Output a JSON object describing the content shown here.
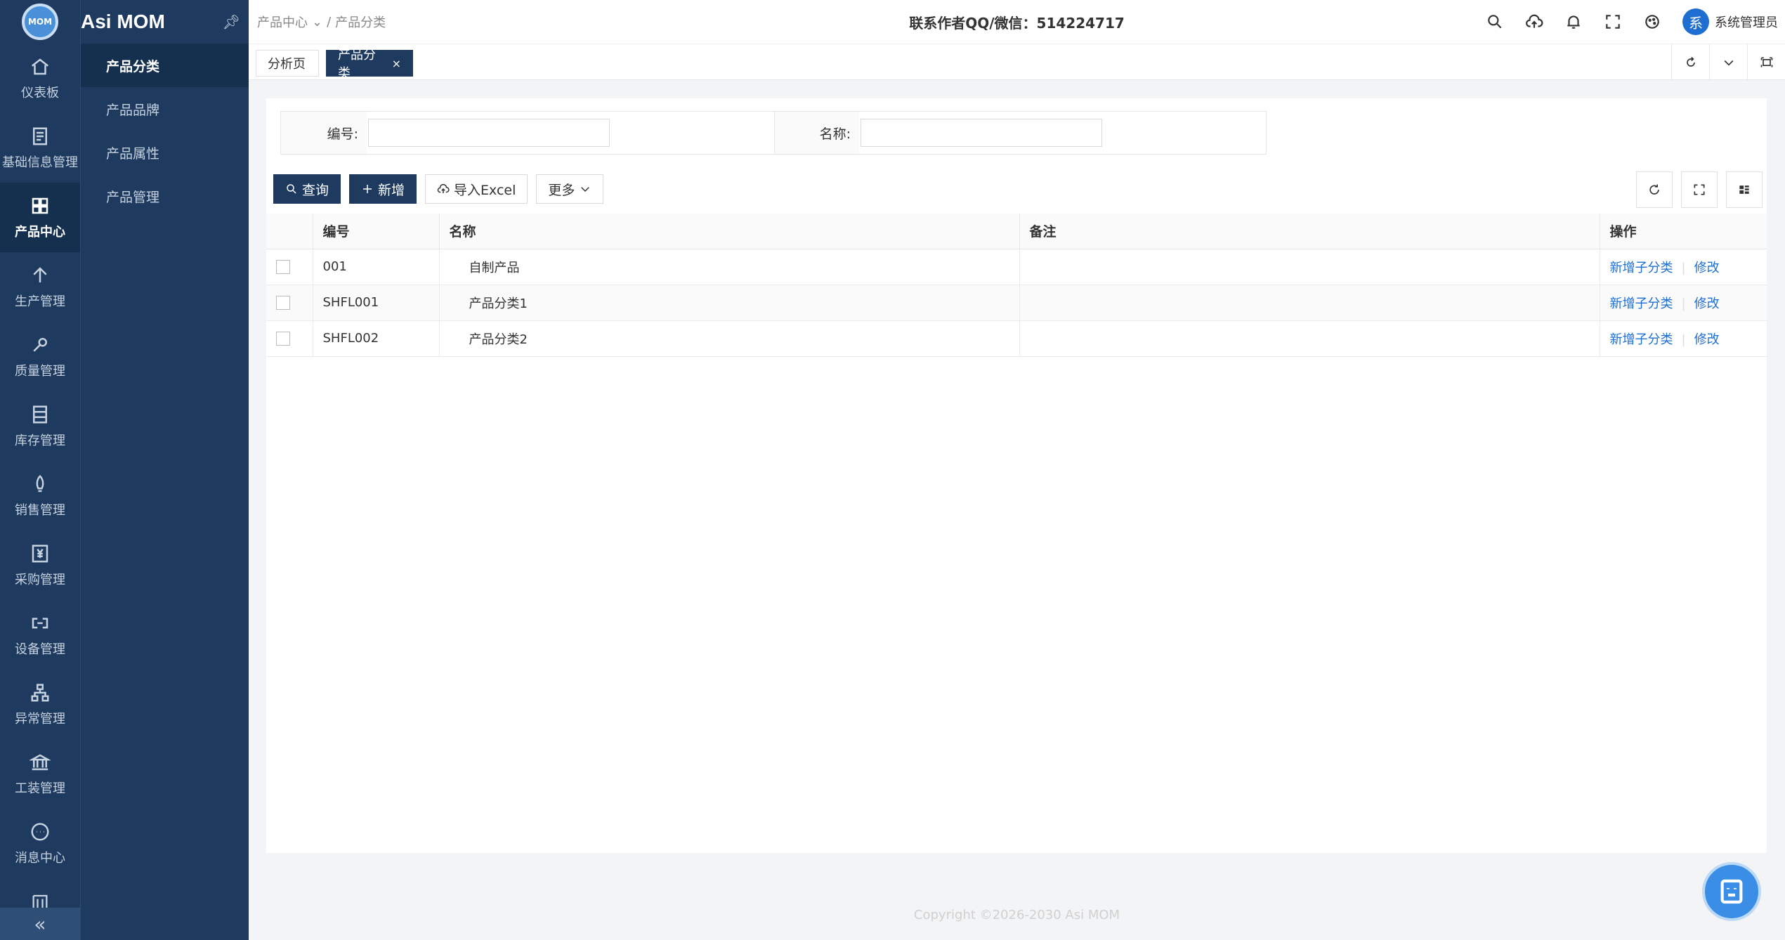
{
  "app": {
    "logo_text": "MOM",
    "title": "Asi MOM"
  },
  "rail": {
    "items": [
      {
        "label": "仪表板",
        "icon": "home-icon"
      },
      {
        "label": "基础信息管理",
        "icon": "document-icon"
      },
      {
        "label": "产品中心",
        "icon": "grid-icon",
        "active": true
      },
      {
        "label": "生产管理",
        "icon": "arrow-up-icon"
      },
      {
        "label": "质量管理",
        "icon": "wrench-icon"
      },
      {
        "label": "库存管理",
        "icon": "warehouse-icon"
      },
      {
        "label": "销售管理",
        "icon": "rocket-icon"
      },
      {
        "label": "采购管理",
        "icon": "yen-icon"
      },
      {
        "label": "设备管理",
        "icon": "device-icon"
      },
      {
        "label": "异常管理",
        "icon": "hierarchy-icon"
      },
      {
        "label": "工装管理",
        "icon": "bank-icon"
      },
      {
        "label": "消息中心",
        "icon": "chat-icon"
      }
    ],
    "collapse_label": "«"
  },
  "submenu": {
    "items": [
      {
        "label": "产品分类",
        "active": true
      },
      {
        "label": "产品品牌"
      },
      {
        "label": "产品属性"
      },
      {
        "label": "产品管理"
      }
    ]
  },
  "topbar": {
    "breadcrumb": [
      "产品中心",
      "产品分类"
    ],
    "contact": "联系作者QQ/微信：514224717",
    "user_name": "系统管理员",
    "avatar_char": "系"
  },
  "tabs": {
    "analysis": "分析页",
    "category": "产品分类",
    "close": "×"
  },
  "search": {
    "code_label": "编号:",
    "name_label": "名称:",
    "code_value": "",
    "name_value": ""
  },
  "buttons": {
    "query": "查询",
    "add": "新增",
    "import": "导入Excel",
    "more": "更多"
  },
  "table": {
    "headers": {
      "code": "编号",
      "name": "名称",
      "remark": "备注",
      "ops": "操作"
    },
    "rows": [
      {
        "code": "001",
        "name": "自制产品",
        "remark": ""
      },
      {
        "code": "SHFL001",
        "name": "产品分类1",
        "remark": ""
      },
      {
        "code": "SHFL002",
        "name": "产品分类2",
        "remark": ""
      }
    ],
    "op_add_child": "新增子分类",
    "op_edit": "修改"
  },
  "footer": {
    "copyright": "Copyright ©2026-2030 Asi MOM"
  },
  "colors": {
    "sidebar": "#1e3a5f",
    "accent": "#1e6fd1",
    "fab": "#3a8ee6"
  }
}
